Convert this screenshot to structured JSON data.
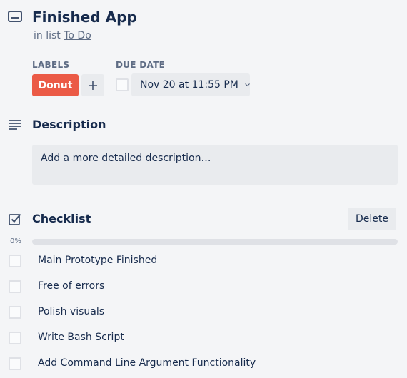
{
  "card": {
    "title": "Finished App",
    "list_prefix": "in list",
    "list_name": "To Do",
    "icon": "card-icon"
  },
  "labels": {
    "heading": "LABELS",
    "items": [
      {
        "text": "Donut",
        "color": "#eb5a46"
      }
    ],
    "add_icon": "plus-icon"
  },
  "due_date": {
    "heading": "DUE DATE",
    "value": "Nov 20 at 11:55 PM",
    "completed": false,
    "chevron_icon": "chevron-down-icon"
  },
  "description": {
    "title": "Description",
    "placeholder": "Add a more detailed description…",
    "icon": "description-icon"
  },
  "checklist": {
    "title": "Checklist",
    "delete_label": "Delete",
    "progress_text": "0%",
    "progress_fraction": 0,
    "icon": "checklist-icon",
    "items": [
      {
        "text": "Main Prototype Finished",
        "checked": false
      },
      {
        "text": "Free of errors",
        "checked": false
      },
      {
        "text": "Polish visuals",
        "checked": false
      },
      {
        "text": "Write Bash Script",
        "checked": false
      },
      {
        "text": "Add Command Line Argument Functionality",
        "checked": false
      }
    ]
  },
  "colors": {
    "background": "#f4f5f7",
    "text": "#172b4d",
    "muted": "#5e6c84",
    "button_bg": "#e9ebee",
    "label_red": "#eb5a46",
    "progress_track": "#dfe1e6"
  }
}
